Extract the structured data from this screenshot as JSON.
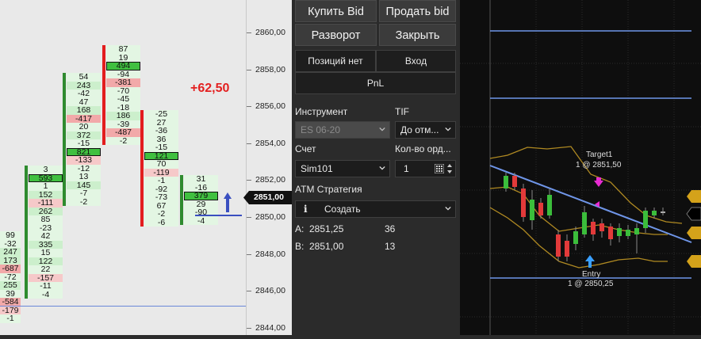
{
  "ladder": {
    "profit": "+62,50",
    "colors": {
      "buy": "#2e8b2e",
      "sell": "#e21e1e",
      "pos_bg": "#ccefcc",
      "neg_bg": "#f2a9a9",
      "neu_bg": "#e3f6e3"
    },
    "columns": [
      {
        "bar": "buy",
        "cells": [
          "99",
          "-32",
          "247",
          "173",
          "-687",
          "-72",
          "255",
          "39",
          "-584",
          "-179",
          "-1"
        ],
        "boxed": []
      },
      {
        "bar": "buy",
        "cells": [
          "3",
          "593",
          "1",
          "152",
          "-111",
          "262",
          "85",
          "-23",
          "42",
          "335",
          "15",
          "122",
          "22",
          "-157",
          "-11",
          "-4"
        ],
        "boxed": [
          1
        ]
      },
      {
        "bar": "buy",
        "cells": [
          "54",
          "243",
          "-42",
          "47",
          "168",
          "-417",
          "20",
          "372",
          "-15",
          "821",
          "-133",
          "-12",
          "13",
          "145",
          "-7",
          "-2"
        ],
        "boxed": [
          9
        ]
      },
      {
        "bar": "sell",
        "cells": [
          "87",
          "19",
          "494",
          "-94",
          "-381",
          "-70",
          "-45",
          "-18",
          "186",
          "-39",
          "-487",
          "-2"
        ],
        "boxed": [
          2
        ]
      },
      {
        "bar": "sell",
        "cells": [
          "-25",
          "27",
          "-36",
          "36",
          "-15",
          "121",
          "70",
          "-119",
          "-1",
          "-92",
          "-73",
          "67",
          "-2",
          "-6"
        ],
        "boxed": [
          5
        ]
      },
      {
        "bar": "buy",
        "cells": [
          "31",
          "-16",
          "379",
          "29",
          "-90",
          "-4"
        ],
        "boxed": [
          2
        ]
      }
    ]
  },
  "price_axis": {
    "labels": [
      "2860,00",
      "2858,00",
      "2856,00",
      "2854,00",
      "2852,00",
      "2850,00",
      "2848,00",
      "2846,00",
      "2844,00"
    ],
    "current_price": "2851,00"
  },
  "order_panel": {
    "buy_bid": "Купить Bid",
    "sell_bid": "Продать bid",
    "reverse": "Разворот",
    "close": "Закрыть",
    "position": "Позиций нет",
    "entry": "Вход",
    "pnl": "PnL",
    "instrument_label": "Инструмент",
    "tif_label": "TIF",
    "instrument_value": "ES 06-20",
    "tif_value": "До отм...",
    "account_label": "Счет",
    "qty_label": "Кол-во орд...",
    "account_value": "Sim101",
    "qty_value": "1",
    "atm_label": "ATM Стратегия",
    "atm_value": "Создать",
    "ask_label": "A:",
    "ask_price": "2851,25",
    "ask_size": "36",
    "bid_label": "B:",
    "bid_price": "2851,00",
    "bid_size": "13"
  },
  "mini_chart": {
    "target_title": "Target1",
    "target_value": "1 @ 2851,50",
    "entry_title": "Entry",
    "entry_value": "1 @ 2850,25"
  }
}
